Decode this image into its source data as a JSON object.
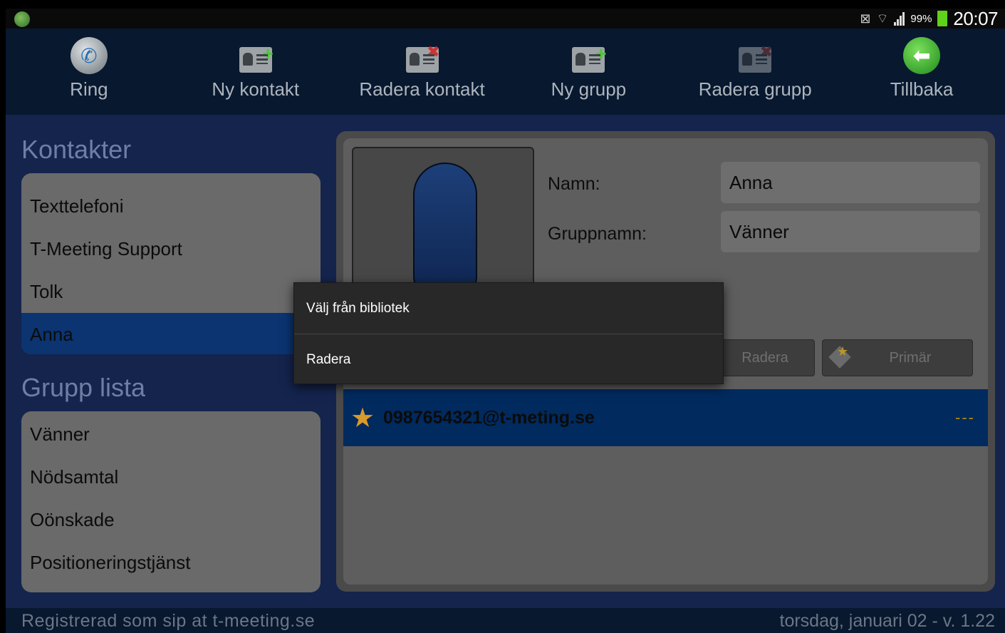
{
  "status_bar": {
    "battery_percent": "99%",
    "time": "20:07",
    "icons": [
      "tmeeting-app-icon",
      "no-sim-icon",
      "wifi-icon",
      "signal-icon",
      "battery-icon"
    ]
  },
  "toolbar": {
    "items": [
      {
        "label": "Ring",
        "icon": "phone-icon"
      },
      {
        "label": "Ny kontakt",
        "icon": "add-contact-icon"
      },
      {
        "label": "Radera kontakt",
        "icon": "delete-contact-icon"
      },
      {
        "label": "Ny grupp",
        "icon": "add-group-icon"
      },
      {
        "label": "Radera grupp",
        "icon": "delete-group-icon"
      },
      {
        "label": "Tillbaka",
        "icon": "back-arrow-icon"
      }
    ]
  },
  "contacts": {
    "title": "Kontakter",
    "items": [
      "Texttelefoni",
      "T-Meeting Support",
      "Tolk",
      "Anna"
    ],
    "selected": "Anna"
  },
  "groups": {
    "title": "Grupp lista",
    "items": [
      "Vänner",
      "Nödsamtal",
      "Oönskade",
      "Positioneringstjänst"
    ]
  },
  "detail": {
    "name_label": "Namn:",
    "name_value": "Anna",
    "group_label": "Gruppnamn:",
    "group_value": "Vänner",
    "delete_button": "Radera",
    "primary_button": "Primär",
    "address": "0987654321@t-meting.se",
    "address_status": "---"
  },
  "context_menu": {
    "items": [
      "Välj från bibliotek",
      "Radera"
    ]
  },
  "footer": {
    "left": "Registrerad som sip at t-meeting.se",
    "right": "torsdag, januari 02 - v. 1.22"
  },
  "colors": {
    "toolbar_bg": "#07182f",
    "main_bg": "#14244d",
    "selected": "#0b3470",
    "address_row": "#012a5e",
    "accent_green": "#3fcf27"
  }
}
